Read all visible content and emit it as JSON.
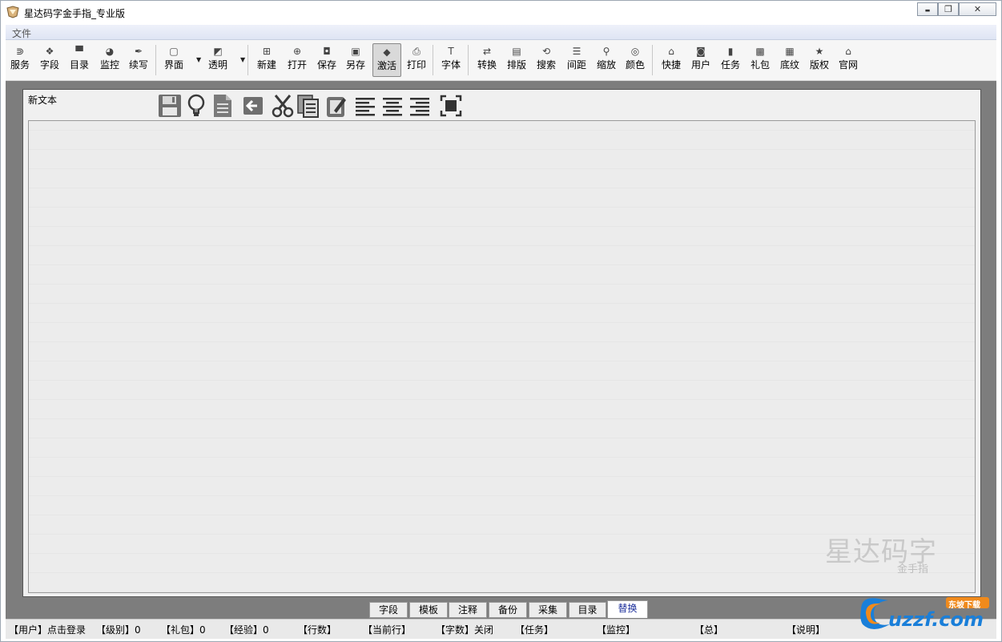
{
  "window": {
    "title": "星达码字金手指_专业版",
    "controls": {
      "minimize": "▬",
      "restore": "❐",
      "close": "✕"
    }
  },
  "menubar": {
    "file": "文件"
  },
  "toolbar": {
    "groups": [
      [
        {
          "label": "服务",
          "icon": "rss-icon",
          "glyph": "⋑"
        },
        {
          "label": "字段",
          "icon": "diamond-icon",
          "glyph": "❖"
        },
        {
          "label": "目录",
          "icon": "folder-icon",
          "glyph": "▀"
        },
        {
          "label": "监控",
          "icon": "eye-icon",
          "glyph": "◕"
        },
        {
          "label": "续写",
          "icon": "pen-icon",
          "glyph": "✒"
        }
      ],
      [
        {
          "label": "界面",
          "icon": "window-icon",
          "glyph": "▢"
        },
        {
          "label": "透明",
          "icon": "transparency-icon",
          "glyph": "◩"
        }
      ],
      [
        {
          "label": "新建",
          "icon": "new-file-icon",
          "glyph": "⊞"
        },
        {
          "label": "打开",
          "icon": "open-file-icon",
          "glyph": "⊕"
        },
        {
          "label": "保存",
          "icon": "save-icon",
          "glyph": "◘"
        },
        {
          "label": "另存",
          "icon": "save-as-icon",
          "glyph": "▣"
        },
        {
          "label": "激活",
          "icon": "activate-icon",
          "glyph": "◆"
        },
        {
          "label": "打印",
          "icon": "print-icon",
          "glyph": "⎙"
        }
      ],
      [
        {
          "label": "字体",
          "icon": "font-icon",
          "glyph": "T"
        }
      ],
      [
        {
          "label": "转换",
          "icon": "convert-icon",
          "glyph": "⇄"
        },
        {
          "label": "排版",
          "icon": "layout-icon",
          "glyph": "▤"
        },
        {
          "label": "搜索",
          "icon": "search-icon",
          "glyph": "⟲"
        },
        {
          "label": "间距",
          "icon": "spacing-icon",
          "glyph": "☰"
        },
        {
          "label": "缩放",
          "icon": "zoom-icon",
          "glyph": "⚲"
        },
        {
          "label": "颜色",
          "icon": "color-icon",
          "glyph": "◎"
        }
      ],
      [
        {
          "label": "快捷",
          "icon": "home-icon",
          "glyph": "⌂"
        },
        {
          "label": "用户",
          "icon": "user-icon",
          "glyph": "◙"
        },
        {
          "label": "任务",
          "icon": "task-icon",
          "glyph": "▮"
        },
        {
          "label": "礼包",
          "icon": "gift-icon",
          "glyph": "▩"
        },
        {
          "label": "底纹",
          "icon": "texture-icon",
          "glyph": "▦"
        },
        {
          "label": "版权",
          "icon": "star-icon",
          "glyph": "★"
        },
        {
          "label": "官网",
          "icon": "house-icon",
          "glyph": "⌂"
        }
      ]
    ],
    "pressed": "激活"
  },
  "document": {
    "title": "新文本",
    "tools": [
      {
        "icon": "save-icon"
      },
      {
        "icon": "lightbulb-icon"
      },
      {
        "icon": "document-icon"
      },
      {
        "icon": "back-arrow-icon"
      },
      {
        "icon": "scissors-icon"
      },
      {
        "icon": "copy-icon"
      },
      {
        "icon": "paste-icon"
      },
      {
        "icon": "align-left-icon"
      },
      {
        "icon": "align-center-icon"
      },
      {
        "icon": "align-right-icon"
      },
      {
        "icon": "fullscreen-icon"
      }
    ],
    "content": "",
    "watermark": {
      "main": "星达码字",
      "sub": "金手指"
    }
  },
  "tabs": [
    "字段",
    "模板",
    "注释",
    "备份",
    "采集",
    "目录",
    "替换"
  ],
  "active_tab": "替换",
  "statusbar": [
    "【用户】点击登录",
    "【级别】0",
    "【礼包】0",
    "【经验】0",
    "【行数】",
    "【当前行】",
    "【字数】关闭",
    "【任务】",
    "【监控】",
    "【总】",
    "【说明】"
  ],
  "corner_logo": {
    "main": "uzzf.com",
    "badge": "东坡下载"
  },
  "colors": {
    "workarea": "#7d7d7d",
    "active_tab_text": "#1c2f9b",
    "logo_blue": "#1a7fd9",
    "logo_orange": "#f08a1c"
  }
}
